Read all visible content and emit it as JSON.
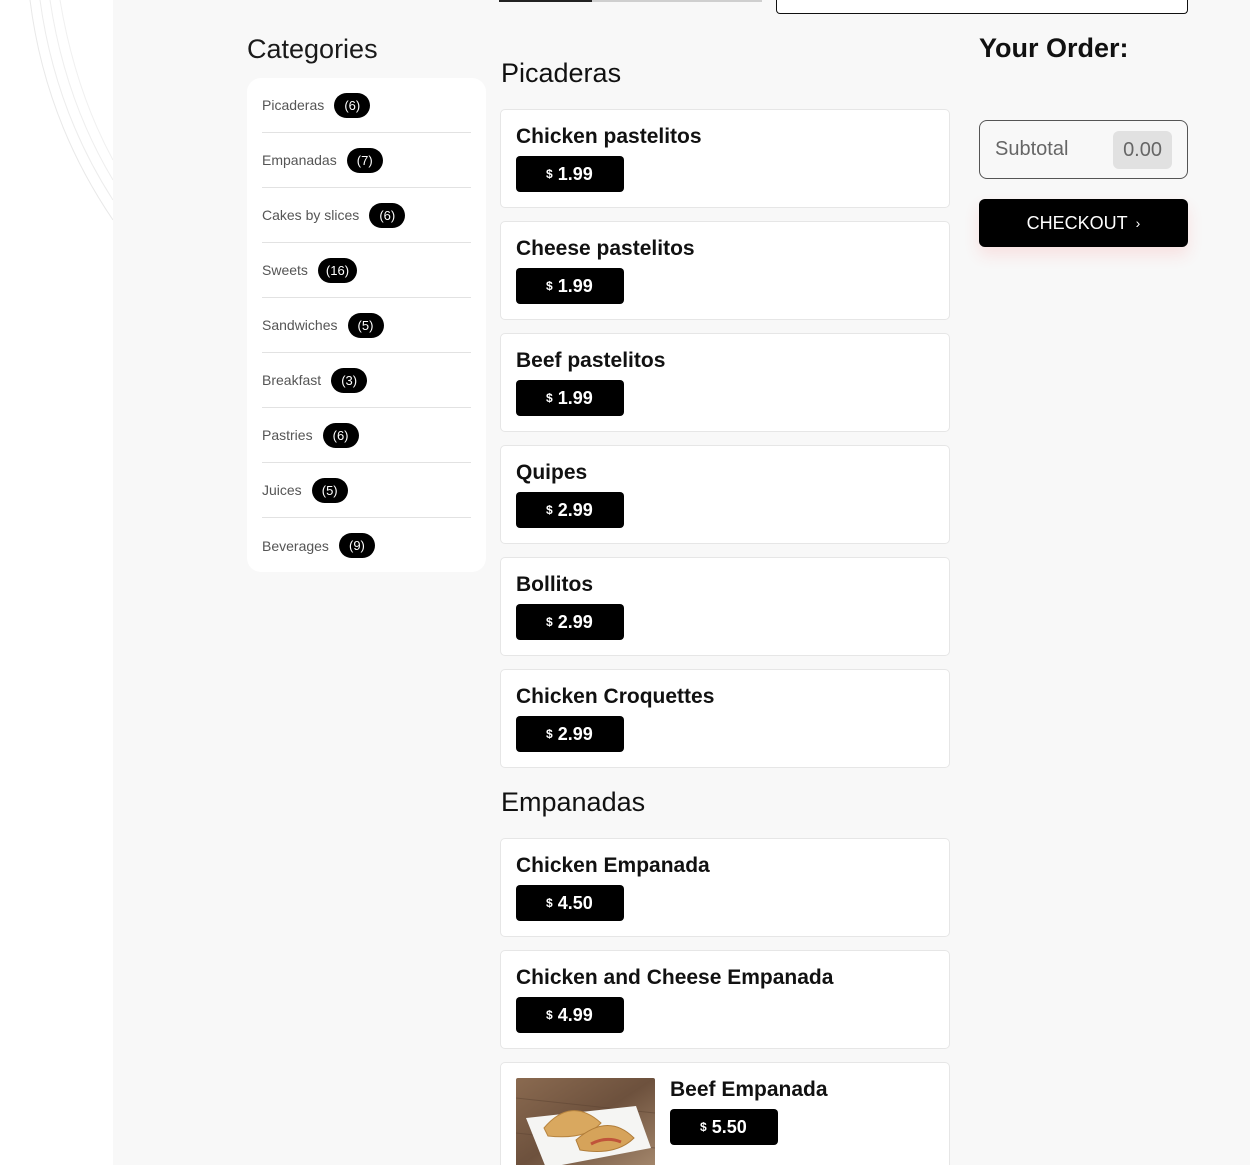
{
  "categories": {
    "title": "Categories",
    "items": [
      {
        "label": "Picaderas",
        "count": "(6)"
      },
      {
        "label": "Empanadas",
        "count": "(7)"
      },
      {
        "label": "Cakes by slices",
        "count": "(6)"
      },
      {
        "label": "Sweets",
        "count": "(16)"
      },
      {
        "label": "Sandwiches",
        "count": "(5)"
      },
      {
        "label": "Breakfast",
        "count": "(3)"
      },
      {
        "label": "Pastries",
        "count": "(6)"
      },
      {
        "label": "Juices",
        "count": "(5)"
      },
      {
        "label": "Beverages",
        "count": "(9)"
      }
    ]
  },
  "menu": {
    "sections": [
      {
        "title": "Picaderas",
        "items": [
          {
            "name": "Chicken pastelitos",
            "currency": "$",
            "price": "1.99"
          },
          {
            "name": "Cheese pastelitos",
            "currency": "$",
            "price": "1.99"
          },
          {
            "name": "Beef pastelitos",
            "currency": "$",
            "price": "1.99"
          },
          {
            "name": "Quipes",
            "currency": "$",
            "price": "2.99"
          },
          {
            "name": "Bollitos",
            "currency": "$",
            "price": "2.99"
          },
          {
            "name": "Chicken Croquettes",
            "currency": "$",
            "price": "2.99"
          }
        ]
      },
      {
        "title": "Empanadas",
        "items": [
          {
            "name": "Chicken Empanada",
            "currency": "$",
            "price": "4.50"
          },
          {
            "name": "Chicken and Cheese Empanada",
            "currency": "$",
            "price": "4.99"
          },
          {
            "name": "Beef Empanada",
            "currency": "$",
            "price": "5.50"
          }
        ]
      }
    ]
  },
  "order": {
    "title": "Your Order:",
    "subtotal_label": "Subtotal",
    "subtotal_value": "0.00",
    "checkout_label": "CHECKOUT",
    "checkout_icon": "chevron-right-icon"
  },
  "colors": {
    "accent": "#000000",
    "background": "#f8f8f8"
  }
}
